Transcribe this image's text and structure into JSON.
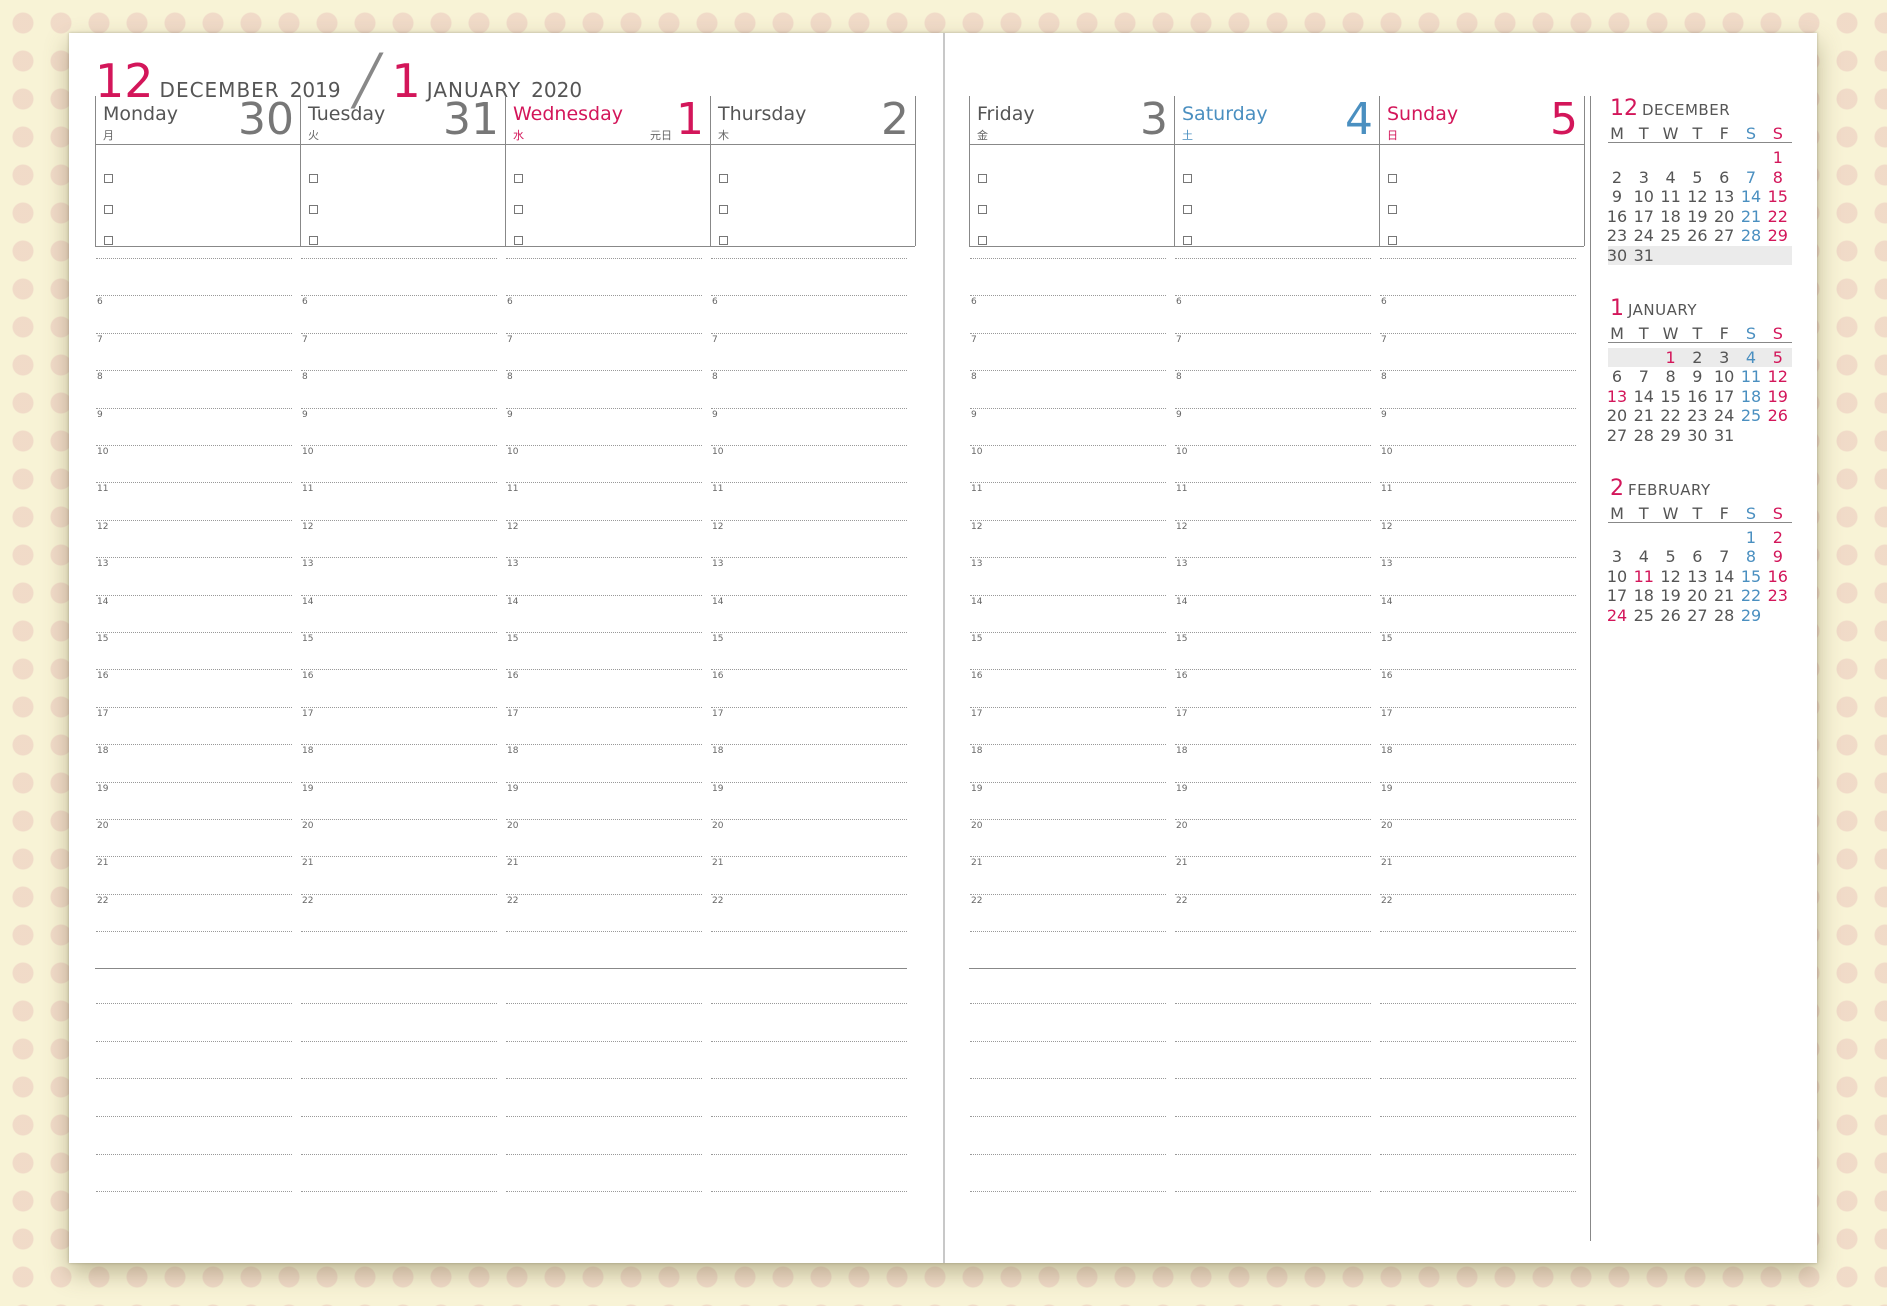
{
  "header": {
    "left_month_num": "12",
    "left_month_name": "DECEMBER",
    "left_year": "2019",
    "right_month_num": "1",
    "right_month_name": "JANUARY",
    "right_year": "2020"
  },
  "colors": {
    "accent_red": "#d3165a",
    "saturday_blue": "#4a8fc0",
    "text_gray": "#555555"
  },
  "days": [
    {
      "name": "Monday",
      "num": "30",
      "kanji": "月",
      "holiday": "",
      "color": "default"
    },
    {
      "name": "Tuesday",
      "num": "31",
      "kanji": "火",
      "holiday": "",
      "color": "default"
    },
    {
      "name": "Wednesday",
      "num": "1",
      "kanji": "水",
      "holiday": "元日",
      "color": "red"
    },
    {
      "name": "Thursday",
      "num": "2",
      "kanji": "木",
      "holiday": "",
      "color": "default"
    },
    {
      "name": "Friday",
      "num": "3",
      "kanji": "金",
      "holiday": "",
      "color": "default"
    },
    {
      "name": "Saturday",
      "num": "4",
      "kanji": "土",
      "holiday": "",
      "color": "blue"
    },
    {
      "name": "Sunday",
      "num": "5",
      "kanji": "日",
      "holiday": "",
      "color": "red"
    }
  ],
  "checkbox_icon": "empty-square-icon",
  "hours": [
    "6",
    "7",
    "8",
    "9",
    "10",
    "11",
    "12",
    "13",
    "14",
    "15",
    "16",
    "17",
    "18",
    "19",
    "20",
    "21",
    "22"
  ],
  "weekday_letters": [
    "M",
    "T",
    "W",
    "T",
    "F",
    "S",
    "S"
  ],
  "mini_calendars": [
    {
      "num": "12",
      "name": "DECEMBER",
      "weeks": [
        [
          "",
          "",
          "",
          "",
          "",
          "",
          "1"
        ],
        [
          "2",
          "3",
          "4",
          "5",
          "6",
          "7",
          "8"
        ],
        [
          "9",
          "10",
          "11",
          "12",
          "13",
          "14",
          "15"
        ],
        [
          "16",
          "17",
          "18",
          "19",
          "20",
          "21",
          "22"
        ],
        [
          "23",
          "24",
          "25",
          "26",
          "27",
          "28",
          "29"
        ],
        [
          "30",
          "31",
          "",
          "",
          "",
          "",
          ""
        ]
      ],
      "red_days": [],
      "shaded_weeks": [
        5
      ]
    },
    {
      "num": "1",
      "name": "JANUARY",
      "weeks": [
        [
          "",
          "",
          "1",
          "2",
          "3",
          "4",
          "5"
        ],
        [
          "6",
          "7",
          "8",
          "9",
          "10",
          "11",
          "12"
        ],
        [
          "13",
          "14",
          "15",
          "16",
          "17",
          "18",
          "19"
        ],
        [
          "20",
          "21",
          "22",
          "23",
          "24",
          "25",
          "26"
        ],
        [
          "27",
          "28",
          "29",
          "30",
          "31",
          "",
          ""
        ]
      ],
      "red_days": [
        "1",
        "13"
      ],
      "shaded_weeks": [
        0
      ]
    },
    {
      "num": "2",
      "name": "FEBRUARY",
      "weeks": [
        [
          "",
          "",
          "",
          "",
          "",
          "1",
          "2"
        ],
        [
          "3",
          "4",
          "5",
          "6",
          "7",
          "8",
          "9"
        ],
        [
          "10",
          "11",
          "12",
          "13",
          "14",
          "15",
          "16"
        ],
        [
          "17",
          "18",
          "19",
          "20",
          "21",
          "22",
          "23"
        ],
        [
          "24",
          "25",
          "26",
          "27",
          "28",
          "29",
          ""
        ]
      ],
      "red_days": [
        "11",
        "24"
      ],
      "shaded_weeks": []
    }
  ]
}
